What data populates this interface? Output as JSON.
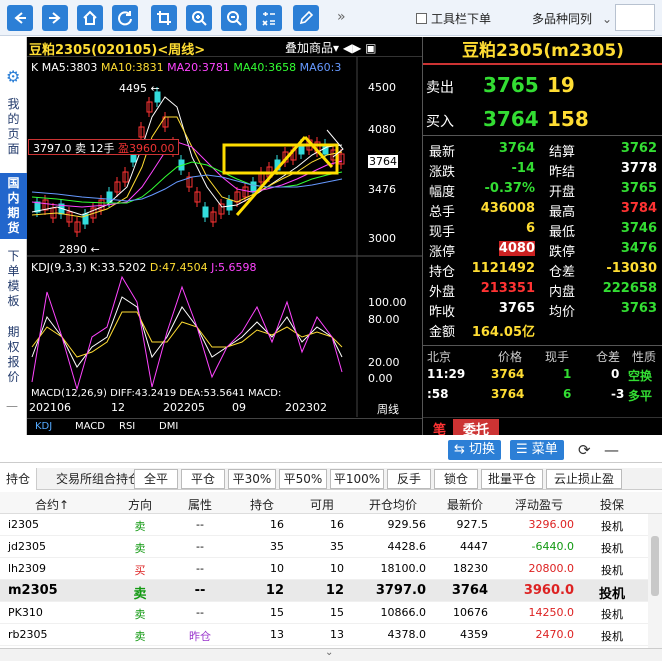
{
  "toolbar": {
    "more": "»",
    "toolbar_label": "工具栏下单",
    "multi_label": "多品种同列"
  },
  "sidebar": [
    {
      "label": "我的页面"
    },
    {
      "label": "国内期货"
    },
    {
      "label": "下单模板"
    },
    {
      "label": "期权报价"
    }
  ],
  "chart": {
    "symbol": "豆粕2305(020105)<周线>",
    "overlay": "叠加商品▾ ◀▶ ▣",
    "ma": [
      {
        "label": "K",
        "color": "#ffffff"
      },
      {
        "label": "MA5:3803",
        "color": "#ffffff"
      },
      {
        "label": "MA10:3831",
        "color": "#ffdd33"
      },
      {
        "label": "MA20:3781",
        "color": "#ff44ff"
      },
      {
        "label": "MA40:3658",
        "color": "#33ff33"
      },
      {
        "label": "MA60:3",
        "color": "#6699ff"
      }
    ],
    "high_label": "4495 ←",
    "low_label": "2890 ←",
    "position": {
      "prefix": "3797.0 卖 12手",
      "pnl": "盈3960.00"
    },
    "price_ticks": [
      "4500",
      "4080",
      "3764",
      "3476",
      "3000"
    ],
    "kdj": [
      {
        "label": "KDJ(9,3,3)",
        "color": "#ffffff"
      },
      {
        "label": "K:33.5202",
        "color": "#ffffff"
      },
      {
        "label": "D:47.4504",
        "color": "#ffdd33"
      },
      {
        "label": "J:5.6598",
        "color": "#ff44ff"
      }
    ],
    "kdj_ticks": [
      "100.00",
      "80.00",
      "20.00",
      "0.00"
    ],
    "macd": "MACD(12,26,9) DIFF:43.2419 DEA:53.5641 MACD:",
    "dates": [
      "202106",
      "12",
      "202205",
      "09",
      "202302",
      "周线"
    ],
    "tabs": [
      "KDJ",
      "MACD",
      "RSI",
      "DMI"
    ]
  },
  "quote": {
    "title": "豆粕2305(m2305)",
    "sell_label": "卖出",
    "sell_price": "3765",
    "sell_vol": "19",
    "buy_label": "买入",
    "buy_price": "3764",
    "buy_vol": "158",
    "rows": [
      {
        "l1": "最新",
        "v1": "3764",
        "c1": "g",
        "l2": "结算",
        "v2": "3762",
        "c2": "g"
      },
      {
        "l1": "涨跌",
        "v1": "-14",
        "c1": "g",
        "l2": "昨结",
        "v2": "3778",
        "c2": "w"
      },
      {
        "l1": "幅度",
        "v1": "-0.37%",
        "c1": "g",
        "l2": "开盘",
        "v2": "3765",
        "c2": "g"
      },
      {
        "l1": "总手",
        "v1": "436008",
        "c1": "y",
        "l2": "最高",
        "v2": "3784",
        "c2": "r"
      },
      {
        "l1": "现手",
        "v1": "6",
        "c1": "y",
        "l2": "最低",
        "v2": "3746",
        "c2": "g"
      },
      {
        "l1": "涨停",
        "v1": "4080",
        "c1": "r",
        "l2": "跌停",
        "v2": "3476",
        "c2": "g"
      },
      {
        "l1": "持仓",
        "v1": "1121492",
        "c1": "y",
        "l2": "仓差",
        "v2": "-13030",
        "c2": "y"
      },
      {
        "l1": "外盘",
        "v1": "213351",
        "c1": "r",
        "l2": "内盘",
        "v2": "222658",
        "c2": "g"
      },
      {
        "l1": "昨收",
        "v1": "3765",
        "c1": "w",
        "l2": "均价",
        "v2": "3763",
        "c2": "g"
      },
      {
        "l1": "金额",
        "v1": "164.05亿",
        "c1": "y",
        "l2": "",
        "v2": "",
        "c2": "w"
      }
    ],
    "tick_header": [
      "北京",
      "价格",
      "现手",
      "仓差",
      "性质"
    ],
    "ticks": [
      [
        "11:29",
        "3764",
        "1",
        "0",
        "空换"
      ],
      [
        ":58",
        "3764",
        "6",
        "-3",
        "多平"
      ]
    ],
    "bottom": [
      "笔",
      "委托"
    ]
  },
  "switch_bar": {
    "switch": "⇆ 切换",
    "menu": "☰ 菜单",
    "refresh": "⟳",
    "dash": "—"
  },
  "tabs": [
    "持仓",
    "交易所组合持仓"
  ],
  "actions": [
    "全平",
    "平仓",
    "平30%",
    "平50%",
    "平100%",
    "反手",
    "锁仓",
    "批量平仓",
    "云止损止盈"
  ],
  "columns": [
    "合约↑",
    "方向",
    "属性",
    "持仓",
    "可用",
    "开仓均价",
    "最新价",
    "浮动盈亏",
    "投保"
  ],
  "rows": [
    {
      "code": "i2305",
      "dir": "卖",
      "dc": "#119911",
      "attr": "--",
      "hold": "16",
      "avail": "16",
      "open": "929.56",
      "last": "927.5",
      "pnl": "3296.00",
      "pc": "#dd2222",
      "hedge": "投机",
      "sel": false
    },
    {
      "code": "jd2305",
      "dir": "卖",
      "dc": "#119911",
      "attr": "--",
      "hold": "35",
      "avail": "35",
      "open": "4428.6",
      "last": "4447",
      "pnl": "-6440.0",
      "pc": "#119911",
      "hedge": "投机",
      "sel": false
    },
    {
      "code": "lh2309",
      "dir": "买",
      "dc": "#dd2222",
      "attr": "--",
      "hold": "10",
      "avail": "10",
      "open": "18100.0",
      "last": "18230",
      "pnl": "20800.0",
      "pc": "#dd2222",
      "hedge": "投机",
      "sel": false
    },
    {
      "code": "m2305",
      "dir": "卖",
      "dc": "#119911",
      "attr": "--",
      "hold": "12",
      "avail": "12",
      "open": "3797.0",
      "last": "3764",
      "pnl": "3960.0",
      "pc": "#dd2222",
      "hedge": "投机",
      "sel": true
    },
    {
      "code": "PK310",
      "dir": "卖",
      "dc": "#119911",
      "attr": "--",
      "hold": "15",
      "avail": "15",
      "open": "10866.0",
      "last": "10676",
      "pnl": "14250.0",
      "pc": "#dd2222",
      "hedge": "投机",
      "sel": false
    },
    {
      "code": "rb2305",
      "dir": "卖",
      "dc": "#119911",
      "attr": "昨仓",
      "hold": "13",
      "avail": "13",
      "open": "4378.0",
      "last": "4359",
      "pnl": "2470.0",
      "pc": "#dd2222",
      "hedge": "投机",
      "sel": false
    }
  ]
}
